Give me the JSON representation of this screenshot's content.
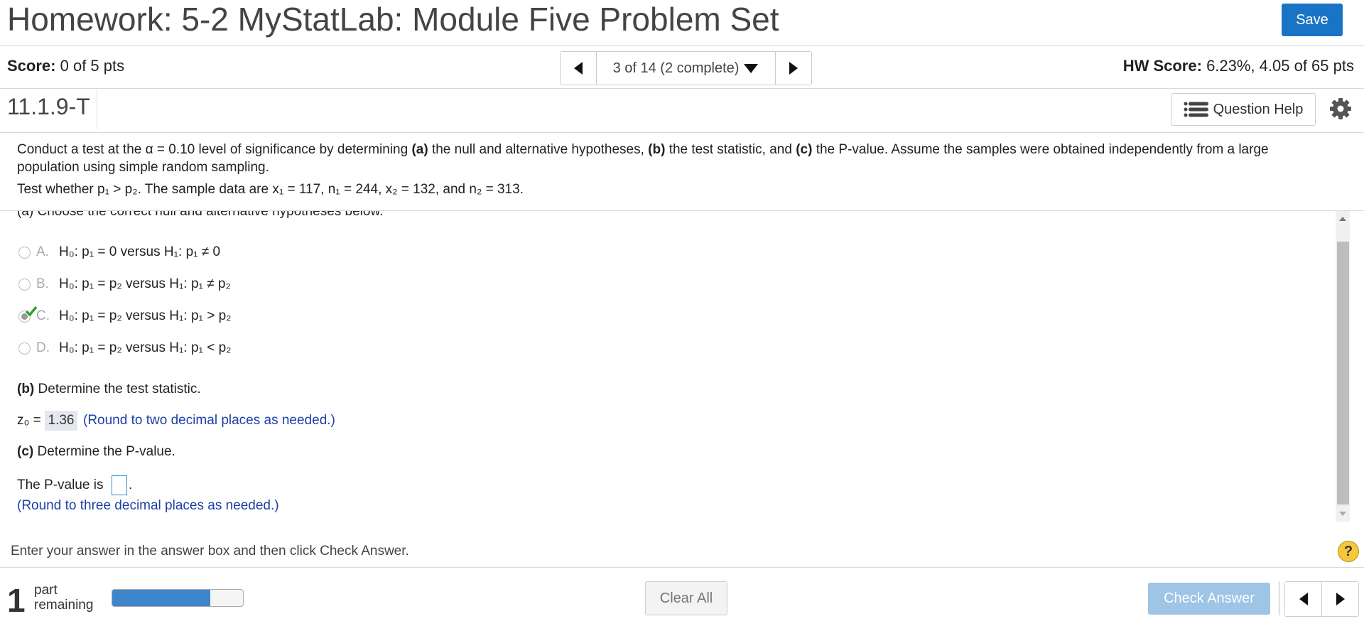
{
  "header": {
    "title": "Homework: 5-2 MyStatLab: Module Five Problem Set",
    "save_label": "Save"
  },
  "scorebar": {
    "score_label": "Score:",
    "score_value": "0 of 5 pts",
    "position": "3 of 14 (2 complete)",
    "hw_label": "HW Score:",
    "hw_value": "6.23%, 4.05 of 65 pts"
  },
  "question": {
    "id": "11.1.9-T",
    "help_label": "Question Help"
  },
  "prompt": {
    "line1_pre": "Conduct a test at the α = 0.10 level of significance by determining ",
    "a": "(a)",
    "a_text": " the null and alternative hypotheses, ",
    "b": "(b)",
    "b_text": " the test statistic, and ",
    "c": "(c)",
    "c_text": " the P-value. Assume the samples were obtained independently from a large population using simple random sampling.",
    "test_text": "Test whether p₁ > p₂. The sample data are x₁ = 117, n₁ = 244, x₂ = 132, and n₂ = 313."
  },
  "part_a": {
    "cut_label": "(a) Choose the correct null and alternative hypotheses below.",
    "options": [
      {
        "letter": "A.",
        "text": "H₀: p₁ = 0 versus H₁: p₁ ≠ 0",
        "selected": false
      },
      {
        "letter": "B.",
        "text": "H₀: p₁ = p₂ versus H₁: p₁ ≠ p₂",
        "selected": false
      },
      {
        "letter": "C.",
        "text": "H₀: p₁ = p₂ versus H₁: p₁ > p₂",
        "selected": true
      },
      {
        "letter": "D.",
        "text": "H₀: p₁ = p₂ versus H₁: p₁ < p₂",
        "selected": false
      }
    ]
  },
  "part_b": {
    "label": "(b)",
    "text": " Determine the test statistic.",
    "z_label": "z₀ =",
    "z_value": "1.36",
    "hint": "(Round to two decimal places as needed.)"
  },
  "part_c": {
    "label": "(c)",
    "text": " Determine the P-value.",
    "pvalue_pre": "The P-value is",
    "pvalue_value": "",
    "hint": "(Round to three decimal places as needed.)"
  },
  "instruction": "Enter your answer in the answer box and then click Check Answer.",
  "footer": {
    "parts_count": "1",
    "parts_line1": "part",
    "parts_line2": "remaining",
    "progress_fraction": 0.75,
    "clear_label": "Clear All",
    "check_label": "Check Answer"
  },
  "colors": {
    "accent": "#1a74c6",
    "check_disabled": "#9ec4e6",
    "hint_blue": "#1e3fa6",
    "correct_green": "#2da12d"
  },
  "icons": [
    "chevron-left-icon",
    "caret-down-icon",
    "chevron-right-icon",
    "list-icon",
    "gear-icon",
    "checkmark-icon",
    "help-icon"
  ]
}
